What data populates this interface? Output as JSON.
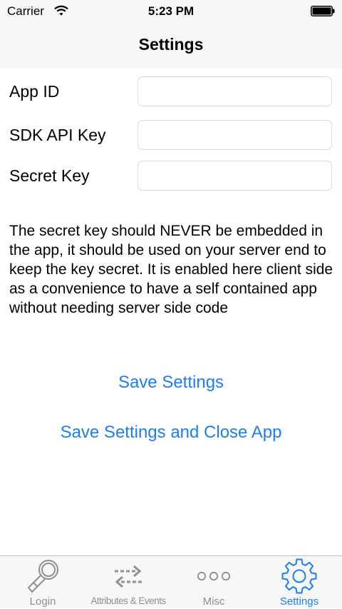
{
  "status_bar": {
    "carrier": "Carrier",
    "time": "5:23 PM"
  },
  "nav": {
    "title": "Settings"
  },
  "form": {
    "app_id_label": "App ID",
    "app_id_value": "",
    "sdk_api_key_label": "SDK API Key",
    "sdk_api_key_value": "",
    "secret_key_label": "Secret Key",
    "secret_key_value": ""
  },
  "note": "The secret key should NEVER be embedded in the app, it should be used on your server end to keep the key secret. It is enabled here client side as a convenience to have a self contained app without needing server side code",
  "actions": {
    "save": "Save Settings",
    "save_close": "Save Settings and Close App"
  },
  "tabs": [
    {
      "label": "Login",
      "icon": "key-icon",
      "active": false
    },
    {
      "label": "Attributes & Events",
      "icon": "swap-arrows-icon",
      "active": false
    },
    {
      "label": "Misc",
      "icon": "more-dots-icon",
      "active": false
    },
    {
      "label": "Settings",
      "icon": "gear-icon",
      "active": true
    }
  ],
  "colors": {
    "accent": "#1a7ff5",
    "inactive": "#8f8f8f",
    "bar_bg": "#f7f7f7"
  }
}
